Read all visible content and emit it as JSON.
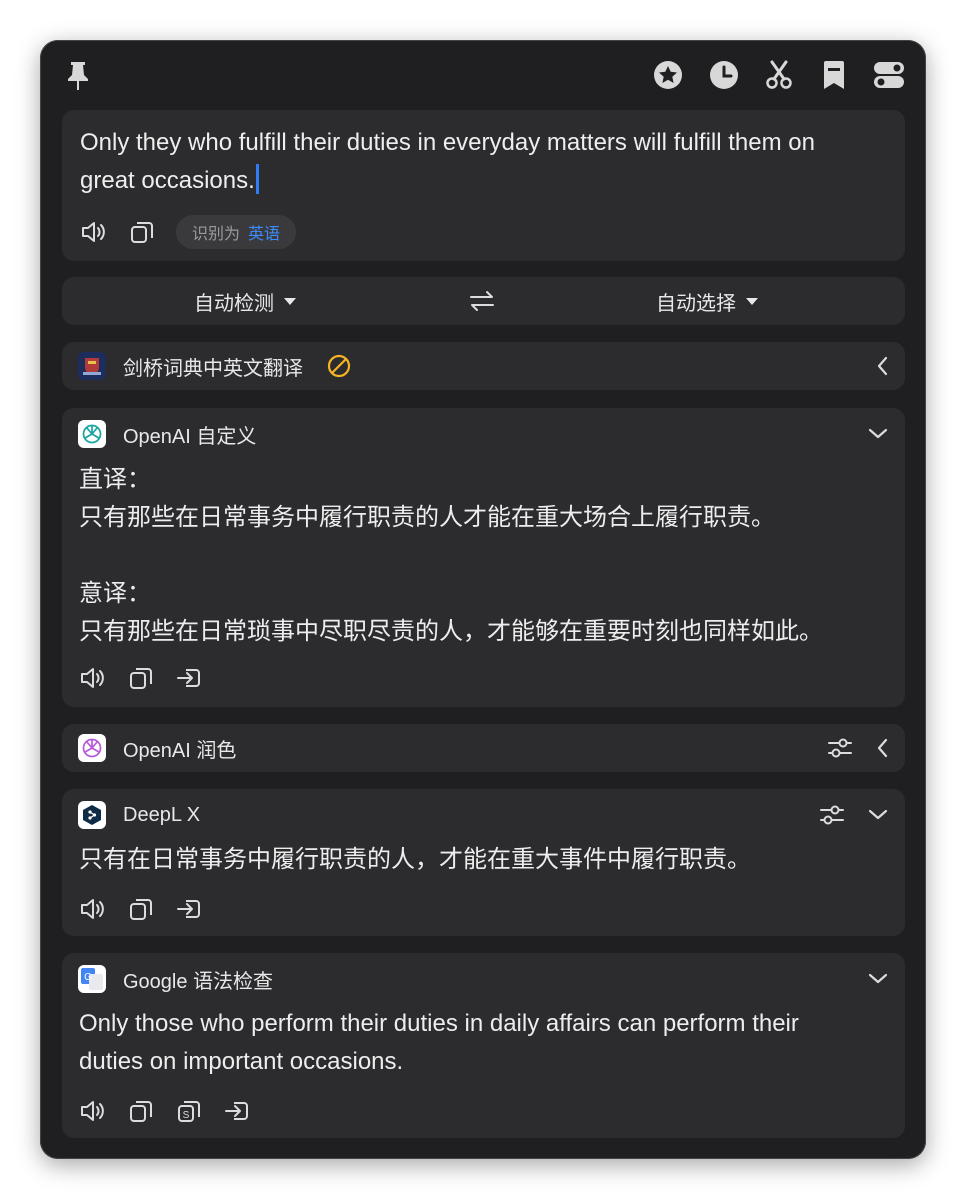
{
  "window": {
    "titlebar_icons": [
      "pin-icon",
      "star-icon",
      "history-icon",
      "scissors-icon",
      "bookmark-icon",
      "toggle-icon"
    ]
  },
  "input": {
    "text": "Only they who fulfill their duties in everyday matters will fulfill them on great occasions.",
    "detect_prefix": "识别为",
    "detect_lang": "英语"
  },
  "languages": {
    "source": "自动检测",
    "target": "自动选择",
    "swap_icon": "swap-icon"
  },
  "services": {
    "cambridge": {
      "name": "剑桥词典中英文翻译",
      "status_icon": "disabled-icon"
    },
    "openai_custom": {
      "name": "OpenAI 自定义",
      "result_lines": [
        "直译：",
        "只有那些在日常事务中履行职责的人才能在重大场合上履行职责。",
        "",
        "意译：",
        "只有那些在日常琐事中尽职尽责的人，才能够在重要时刻也同样如此。"
      ]
    },
    "openai_polish": {
      "name": "OpenAI 润色"
    },
    "deepl": {
      "name": "DeepL X",
      "result": "只有在日常事务中履行职责的人，才能在重大事件中履行职责。"
    },
    "google_grammar": {
      "name": "Google 语法检查",
      "result_lines": [
        "Only those who perform their duties in daily affairs can perform their",
        "duties on important occasions."
      ]
    }
  },
  "colors": {
    "window_bg": "#1f1f21",
    "card_bg": "#2c2c2f",
    "accent_blue": "#3d8bfd",
    "warning_yellow": "#f5b325"
  }
}
